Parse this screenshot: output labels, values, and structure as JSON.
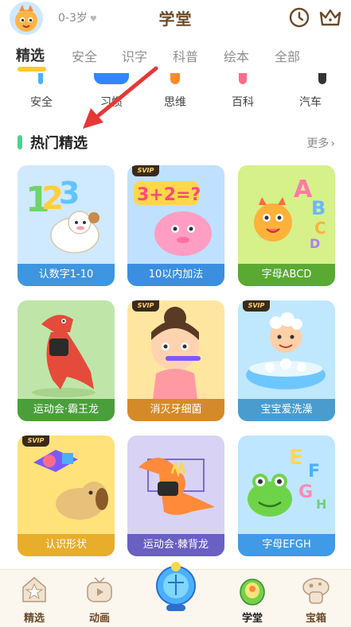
{
  "header": {
    "age": "0-3岁",
    "title": "学堂",
    "icons": [
      "avatar-dragon",
      "clock-icon",
      "crown-icon"
    ]
  },
  "tabs": [
    {
      "label": "精选",
      "active": true
    },
    {
      "label": "安全"
    },
    {
      "label": "识字"
    },
    {
      "label": "科普"
    },
    {
      "label": "绘本"
    },
    {
      "label": "全部"
    }
  ],
  "categories": [
    {
      "label": "安全",
      "color": "#4ab0ff"
    },
    {
      "label": "习惯",
      "color": "#2f86ff"
    },
    {
      "label": "思维",
      "color": "#ff8a2a"
    },
    {
      "label": "百科",
      "color": "#ff6b8a"
    },
    {
      "label": "汽车",
      "color": "#333333"
    }
  ],
  "section": {
    "title": "热门精选",
    "more": "更多"
  },
  "cards": [
    {
      "label": "认数字1-10",
      "bg": "#cfe9ff",
      "bar": "#3e95e0",
      "svip": false,
      "icon": "sheep-numbers"
    },
    {
      "label": "10以内加法",
      "bg": "#bfe0ff",
      "bar": "#3a8fe0",
      "svip": true,
      "icon": "pink-pig-math"
    },
    {
      "label": "字母ABCD",
      "bg": "#d6f08a",
      "bar": "#5aa933",
      "svip": false,
      "icon": "dragon-letters"
    },
    {
      "label": "运动会·霸王龙",
      "bg": "#bfe6a8",
      "bar": "#4a9f3b",
      "svip": false,
      "icon": "trex"
    },
    {
      "label": "消灭牙细菌",
      "bg": "#ffe6a0",
      "bar": "#d58a2a",
      "svip": true,
      "icon": "girl-toothbrush"
    },
    {
      "label": "宝宝爱洗澡",
      "bg": "#bfe8ff",
      "bar": "#4a9ccf",
      "svip": true,
      "icon": "bath-baby"
    },
    {
      "label": "认识形状",
      "bg": "#ffe27a",
      "bar": "#e8ad2a",
      "svip": true,
      "icon": "shapes-dog"
    },
    {
      "label": "运动会·棘背龙",
      "bg": "#d8d2f4",
      "bar": "#6a5fc2",
      "svip": false,
      "icon": "spinosaurus"
    },
    {
      "label": "字母EFGH",
      "bg": "#bfe6ff",
      "bar": "#3f9ae8",
      "svip": false,
      "icon": "frog-letters"
    }
  ],
  "bottom_nav": [
    {
      "label": "精选",
      "active": false
    },
    {
      "label": "动画",
      "active": false
    },
    {
      "label": "",
      "active": false
    },
    {
      "label": "学堂",
      "active": true
    },
    {
      "label": "宝箱",
      "active": false
    }
  ]
}
